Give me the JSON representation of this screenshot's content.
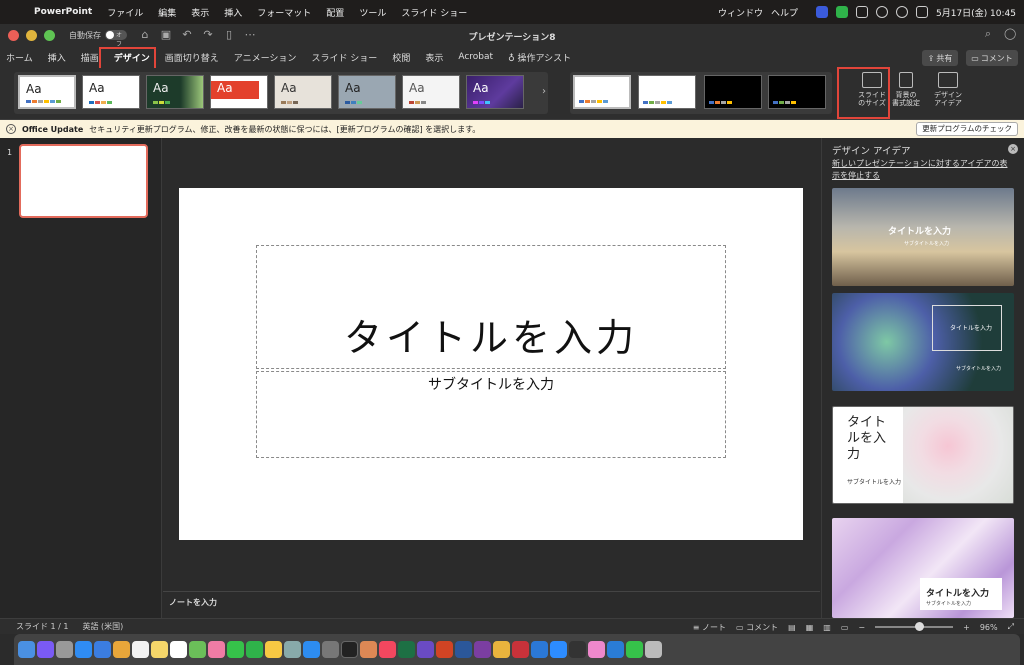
{
  "menubar": {
    "app": "PowerPoint",
    "items": [
      "ファイル",
      "編集",
      "表示",
      "挿入",
      "フォーマット",
      "配置",
      "ツール",
      "スライド ショー",
      "ウィンドウ",
      "ヘルプ"
    ],
    "date_time": "5月17日(金)  10:45"
  },
  "titlebar": {
    "autosave_label": "自動保存",
    "autosave_state": "オフ",
    "doc_title": "プレゼンテーション8"
  },
  "ribbon_tabs": [
    "ホーム",
    "挿入",
    "描画",
    "デザイン",
    "画面切り替え",
    "アニメーション",
    "スライド ショー",
    "校閲",
    "表示",
    "Acrobat",
    "操作アシスト"
  ],
  "active_tab": "デザイン",
  "share_label": "共有",
  "comment_label": "コメント",
  "themes": {
    "preview_text": "Aa"
  },
  "ribbon_buttons": {
    "slide_size": "スライド\nのサイズ",
    "format_background": "背景の\n書式設定",
    "design_ideas": "デザイン\nアイデア"
  },
  "update_bar": {
    "name": "Office Update",
    "message": "セキュリティ更新プログラム、修正、改善を最新の状態に保つには、[更新プログラムの確認] を選択します。",
    "button": "更新プログラムのチェック"
  },
  "slide_panel": {
    "slide_number": "1"
  },
  "slide": {
    "title_placeholder": "タイトルを入力",
    "subtitle_placeholder": "サブタイトルを入力"
  },
  "notes_placeholder": "ノートを入力",
  "design_ideas": {
    "title": "デザイン アイデア",
    "stop_link": "新しいプレゼンテーションに対するアイデアの表示を停止する",
    "idea_title": "タイトルを入力",
    "idea_subtitle": "サブタイトルを入力",
    "idea3_title": "タイトルを入力"
  },
  "statusbar": {
    "slide_info": "スライド 1 / 1",
    "language": "英語 (米国)",
    "notes": "ノート",
    "comments": "コメント",
    "zoom": "96%"
  },
  "colors": {
    "highlight": "#e2453a",
    "slide_selected_border": "#e36b5c",
    "update_bar_bg": "#fbf3dc"
  }
}
